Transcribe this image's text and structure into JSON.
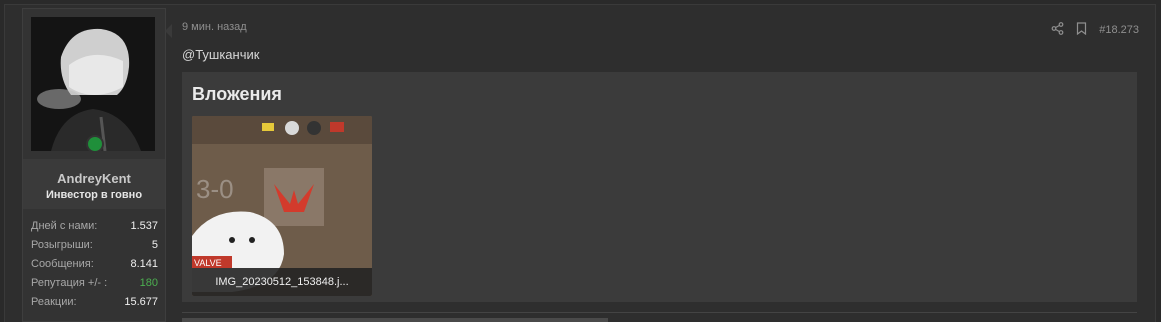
{
  "user": {
    "name": "AndreyKent",
    "title": "Инвестор в говно",
    "stats": [
      {
        "label": "Дней с нами:",
        "value": "1.537"
      },
      {
        "label": "Розыгрыши:",
        "value": "5"
      },
      {
        "label": "Сообщения:",
        "value": "8.141"
      },
      {
        "label": "Репутация +/- :",
        "value": "180"
      },
      {
        "label": "Реакции:",
        "value": "15.677"
      }
    ]
  },
  "post": {
    "time": "9 мин. назад",
    "number": "#18.273",
    "mention": "@Тушканчик",
    "attachments_title": "Вложения",
    "attachment": {
      "filename": "IMG_20230512_153848.j...",
      "score_text": "3-0",
      "badge_text": "VALVE"
    }
  },
  "icons": {
    "share": "share-icon",
    "bookmark": "bookmark-icon",
    "online": "online-status-icon"
  }
}
